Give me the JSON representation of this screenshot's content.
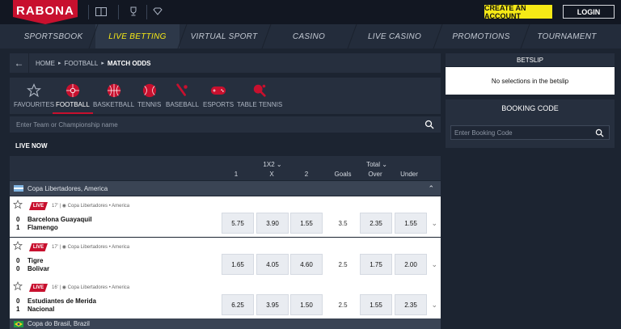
{
  "brand": {
    "logo_text": "RABONA",
    "accent": "#c8102e",
    "yellow": "#f6e916"
  },
  "topbar": {
    "create_account": "CREATE AN ACCOUNT",
    "login": "LOGIN",
    "icons": [
      "book-icon",
      "trophy-icon",
      "diamond-icon"
    ]
  },
  "nav": {
    "items": [
      "SPORTSBOOK",
      "LIVE BETTING",
      "VIRTUAL SPORT",
      "CASINO",
      "LIVE CASINO",
      "PROMOTIONS",
      "TOURNAMENT"
    ],
    "active": "LIVE BETTING"
  },
  "breadcrumb": {
    "home": "HOME",
    "football": "FOOTBALL",
    "current": "MATCH ODDS"
  },
  "sports": [
    {
      "label": "FAVOURITES",
      "icon": "star-icon"
    },
    {
      "label": "FOOTBALL",
      "icon": "football-icon",
      "active": true
    },
    {
      "label": "BASKETBALL",
      "icon": "basketball-icon"
    },
    {
      "label": "TENNIS",
      "icon": "tennis-icon"
    },
    {
      "label": "BASEBALL",
      "icon": "baseball-icon"
    },
    {
      "label": "ESPORTS",
      "icon": "gamepad-icon"
    },
    {
      "label": "TABLE TENNIS",
      "icon": "table-tennis-icon"
    }
  ],
  "search": {
    "placeholder": "Enter Team or Championship name"
  },
  "live_now": "LIVE NOW",
  "odds_header": {
    "group1": "1X2",
    "group2": "Total",
    "col_1": "1",
    "col_x": "X",
    "col_2": "2",
    "goals": "Goals",
    "over": "Over",
    "under": "Under"
  },
  "league1": {
    "name": "Copa Libertadores, America"
  },
  "league2": {
    "name": "Copa do Brasil, Brazil"
  },
  "matches": [
    {
      "live": "LIVE",
      "minute": "17'",
      "league": "Copa Libertadores",
      "region": "America",
      "home_score": "0",
      "away_score": "1",
      "home": "Barcelona Guayaquil",
      "away": "Flamengo",
      "o1": "5.75",
      "ox": "3.90",
      "o2": "1.55",
      "goals": "3.5",
      "over": "2.35",
      "under": "1.55"
    },
    {
      "live": "LIVE",
      "minute": "17'",
      "league": "Copa Libertadores",
      "region": "America",
      "home_score": "0",
      "away_score": "0",
      "home": "Tigre",
      "away": "Bolivar",
      "o1": "1.65",
      "ox": "4.05",
      "o2": "4.60",
      "goals": "2.5",
      "over": "1.75",
      "under": "2.00"
    },
    {
      "live": "LIVE",
      "minute": "16'",
      "league": "Copa Libertadores",
      "region": "America",
      "home_score": "0",
      "away_score": "1",
      "home": "Estudiantes de Merida",
      "away": "Nacional",
      "o1": "6.25",
      "ox": "3.95",
      "o2": "1.50",
      "goals": "2.5",
      "over": "1.55",
      "under": "2.35"
    }
  ],
  "betslip": {
    "title": "BETSLIP",
    "empty": "No selections in the betslip"
  },
  "booking": {
    "title": "BOOKING CODE",
    "placeholder": "Enter Booking Code"
  }
}
